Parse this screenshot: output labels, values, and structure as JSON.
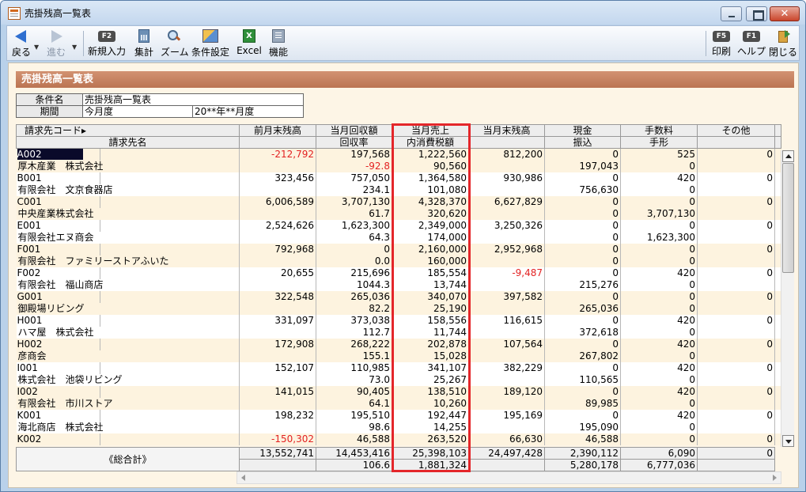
{
  "window": {
    "title": "売掛残高一覧表"
  },
  "toolbar": {
    "back": "戻る",
    "forward": "進む",
    "new_entry": "新規入力",
    "new_entry_key": "F2",
    "summary": "集計",
    "zoom": "ズーム",
    "conditions": "条件設定",
    "excel": "Excel",
    "excel_glyph": "X",
    "functions": "機能",
    "print": "印刷",
    "print_key": "F5",
    "help": "ヘルプ",
    "help_key": "F1",
    "close": "閉じる"
  },
  "section": {
    "title": "売掛残高一覧表"
  },
  "conditions": {
    "name_label": "条件名",
    "name_value": "売掛残高一覧表",
    "period_label": "期間",
    "period_value": "今月度",
    "period_range": "20**年**月度"
  },
  "grid": {
    "headers_row1": [
      "請求先コード▸",
      "前月末残高",
      "当月回収額",
      "当月売上",
      "当月末残高",
      "現金",
      "手数料",
      "その他"
    ],
    "headers_row2": [
      "請求先名",
      "",
      "回収率",
      "内消費税額",
      "",
      "振込",
      "手形",
      ""
    ],
    "records": [
      {
        "code": "A002",
        "name": "厚木産業　株式会社",
        "prev": "-212,792",
        "coll": "197,568",
        "rate": "-92.8",
        "sales": "1,222,560",
        "tax": "90,560",
        "curr": "812,200",
        "cash": "0",
        "transfer": "197,043",
        "fee": "525",
        "bill": "0",
        "other": "0"
      },
      {
        "code": "B001",
        "name": "有限会社　文京食器店",
        "prev": "323,456",
        "coll": "757,050",
        "rate": "234.1",
        "sales": "1,364,580",
        "tax": "101,080",
        "curr": "930,986",
        "cash": "0",
        "transfer": "756,630",
        "fee": "420",
        "bill": "0",
        "other": "0"
      },
      {
        "code": "C001",
        "name": "中央産業株式会社",
        "prev": "6,006,589",
        "coll": "3,707,130",
        "rate": "61.7",
        "sales": "4,328,370",
        "tax": "320,620",
        "curr": "6,627,829",
        "cash": "0",
        "transfer": "0",
        "fee": "0",
        "bill": "3,707,130",
        "other": "0"
      },
      {
        "code": "E001",
        "name": "有限会社エヌ商会",
        "prev": "2,524,626",
        "coll": "1,623,300",
        "rate": "64.3",
        "sales": "2,349,000",
        "tax": "174,000",
        "curr": "3,250,326",
        "cash": "0",
        "transfer": "0",
        "fee": "0",
        "bill": "1,623,300",
        "other": "0"
      },
      {
        "code": "F001",
        "name": "有限会社　ファミリーストアふいた",
        "prev": "792,968",
        "coll": "0",
        "rate": "0.0",
        "sales": "2,160,000",
        "tax": "160,000",
        "curr": "2,952,968",
        "cash": "0",
        "transfer": "0",
        "fee": "0",
        "bill": "0",
        "other": "0"
      },
      {
        "code": "F002",
        "name": "有限会社　福山商店",
        "prev": "20,655",
        "coll": "215,696",
        "rate": "1044.3",
        "sales": "185,554",
        "tax": "13,744",
        "curr": "-9,487",
        "cash": "0",
        "transfer": "215,276",
        "fee": "420",
        "bill": "0",
        "other": "0"
      },
      {
        "code": "G001",
        "name": "御殿場リビング",
        "prev": "322,548",
        "coll": "265,036",
        "rate": "82.2",
        "sales": "340,070",
        "tax": "25,190",
        "curr": "397,582",
        "cash": "0",
        "transfer": "265,036",
        "fee": "0",
        "bill": "0",
        "other": "0"
      },
      {
        "code": "H001",
        "name": "ハマ屋　株式会社",
        "prev": "331,097",
        "coll": "373,038",
        "rate": "112.7",
        "sales": "158,556",
        "tax": "11,744",
        "curr": "116,615",
        "cash": "0",
        "transfer": "372,618",
        "fee": "420",
        "bill": "0",
        "other": "0"
      },
      {
        "code": "H002",
        "name": "彦商会",
        "prev": "172,908",
        "coll": "268,222",
        "rate": "155.1",
        "sales": "202,878",
        "tax": "15,028",
        "curr": "107,564",
        "cash": "0",
        "transfer": "267,802",
        "fee": "420",
        "bill": "0",
        "other": "0"
      },
      {
        "code": "I001",
        "name": "株式会社　池袋リビング",
        "prev": "152,107",
        "coll": "110,985",
        "rate": "73.0",
        "sales": "341,107",
        "tax": "25,267",
        "curr": "382,229",
        "cash": "0",
        "transfer": "110,565",
        "fee": "420",
        "bill": "0",
        "other": "0"
      },
      {
        "code": "I002",
        "name": "有限会社　市川ストア",
        "prev": "141,015",
        "coll": "90,405",
        "rate": "64.1",
        "sales": "138,510",
        "tax": "10,260",
        "curr": "189,120",
        "cash": "0",
        "transfer": "89,985",
        "fee": "420",
        "bill": "0",
        "other": "0"
      },
      {
        "code": "K001",
        "name": "海北商店　株式会社",
        "prev": "198,232",
        "coll": "195,510",
        "rate": "98.6",
        "sales": "192,447",
        "tax": "14,255",
        "curr": "195,169",
        "cash": "0",
        "transfer": "195,090",
        "fee": "420",
        "bill": "0",
        "other": "0"
      },
      {
        "code": "K002",
        "name": "",
        "prev": "-150,302",
        "coll": "46,588",
        "rate": "",
        "sales": "263,520",
        "tax": "",
        "curr": "66,630",
        "cash": "46,588",
        "transfer": "",
        "fee": "0",
        "bill": "",
        "other": "0"
      }
    ]
  },
  "totals": {
    "label": "《総合計》",
    "prev": "13,552,741",
    "coll": "14,453,416",
    "sales": "25,398,103",
    "curr": "24,497,428",
    "cash": "2,390,112",
    "fee": "6,090",
    "other": "0",
    "rate": "106.6",
    "tax": "1,881,324",
    "transfer": "5,280,178",
    "bill": "6,777,036"
  },
  "colors": {
    "header_bar": "#c27a56",
    "negative": "#e32222",
    "highlight_box": "#e4262a",
    "row_alt": "#fdf3df"
  }
}
